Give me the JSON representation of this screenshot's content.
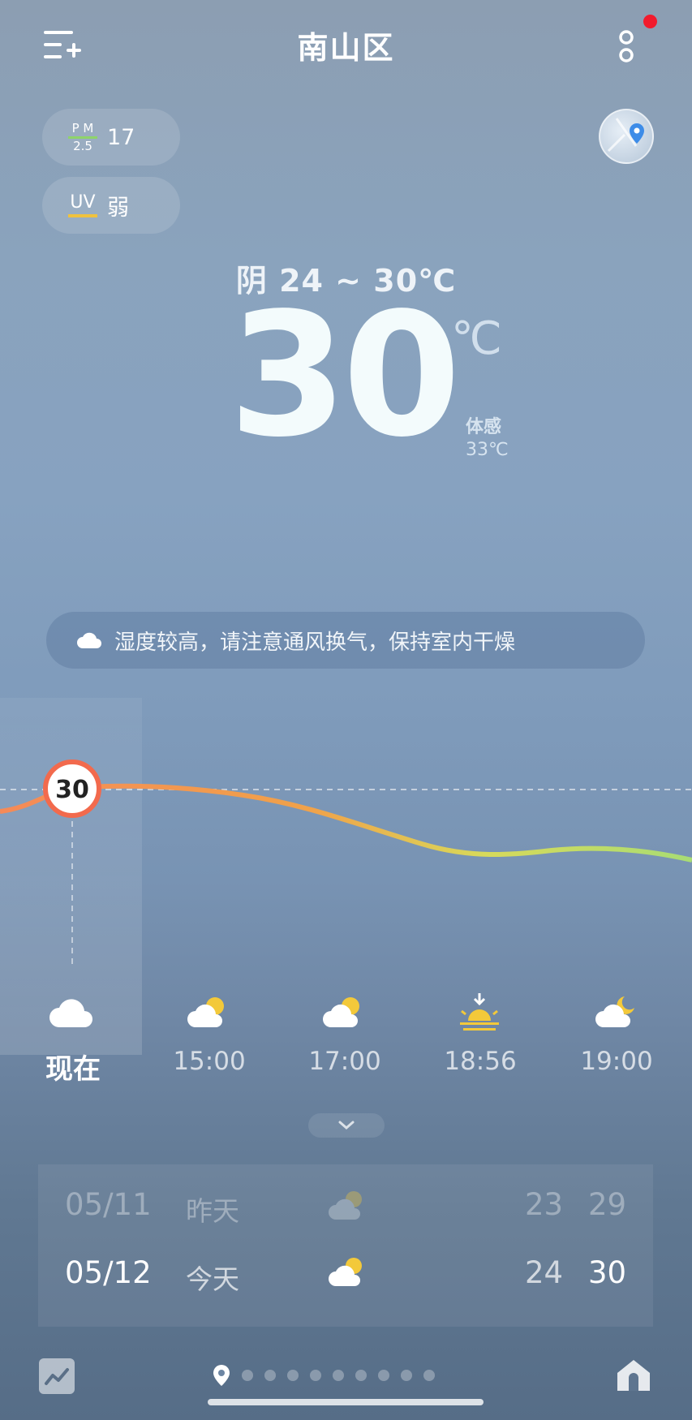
{
  "header": {
    "city": "南山区",
    "menu_icon": "list-add-icon",
    "more_icon": "more-icon"
  },
  "badges": {
    "pm_label_top": "P M",
    "pm_label_bottom": "2.5",
    "pm_value": "17",
    "uv_label": "UV",
    "uv_value": "弱"
  },
  "current": {
    "condition_range": "阴  24 ~ 30℃",
    "temperature": "30",
    "unit": "℃",
    "feels_label": "体感",
    "feels_value": "33℃"
  },
  "tip": {
    "text": "湿度较高，请注意通风换气，保持室内干燥"
  },
  "hourly": {
    "now_temp_marker": "30",
    "items": [
      {
        "label": "现在",
        "icon": "cloud-icon"
      },
      {
        "label": "15:00",
        "icon": "partly-cloudy-icon"
      },
      {
        "label": "17:00",
        "icon": "partly-cloudy-icon"
      },
      {
        "label": "18:56",
        "icon": "sunset-icon"
      },
      {
        "label": "19:00",
        "icon": "cloudy-night-icon"
      }
    ],
    "temps": [
      30,
      30,
      28,
      26,
      26
    ],
    "curve_colors": [
      "#f58a57",
      "#f0a24a",
      "#d8da5a",
      "#a8dc74"
    ]
  },
  "daily": [
    {
      "date": "05/11",
      "day": "昨天",
      "low": "23",
      "high": "29",
      "icon": "partly-cloudy-icon"
    },
    {
      "date": "05/12",
      "day": "今天",
      "low": "24",
      "high": "30",
      "icon": "partly-cloudy-icon"
    }
  ],
  "bottom": {
    "trend_icon": "trend-chart-icon",
    "home_icon": "home-icon",
    "location_icon": "location-pin-icon",
    "page_count": 10
  },
  "colors": {
    "red_dot": "#f21b2d",
    "sun": "#f3c93a"
  }
}
